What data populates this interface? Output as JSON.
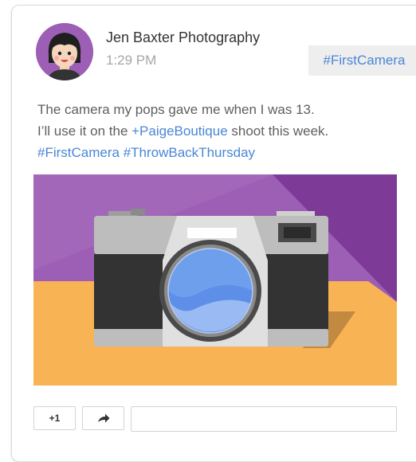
{
  "post": {
    "author": "Jen Baxter Photography",
    "time": "1:29 PM",
    "hashtag_chip": "#FirstCamera",
    "body": {
      "line1": "The camera my pops gave me when I was 13.",
      "line2_prefix": "I’ll use it on the ",
      "line2_link": "+PaigeBoutique",
      "line2_suffix": " shoot this week.",
      "tag1": "#FirstCamera",
      "tag2": "#ThrowBackThursday"
    }
  },
  "actions": {
    "plus_one_label": "+1",
    "share_icon": "share-arrow-icon",
    "comment_placeholder": ""
  },
  "colors": {
    "link": "#4a86d6",
    "photo_purple": "#9c5fb5",
    "photo_table": "#f8b355",
    "camera_body": "#bdbdbd",
    "camera_grip": "#333333"
  }
}
